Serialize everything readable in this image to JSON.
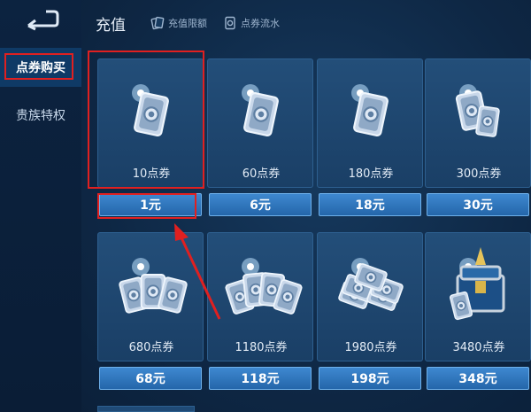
{
  "sidebar": {
    "items": [
      {
        "label": "点券购买",
        "active": true
      },
      {
        "label": "贵族特权",
        "active": false
      }
    ]
  },
  "header": {
    "title": "充值",
    "links": [
      {
        "label": "充值限额",
        "icon": "cards-icon"
      },
      {
        "label": "点券流水",
        "icon": "coin-icon"
      }
    ]
  },
  "products": [
    {
      "amount": "10点券",
      "price": "1元"
    },
    {
      "amount": "60点券",
      "price": "6元"
    },
    {
      "amount": "180点券",
      "price": "18元"
    },
    {
      "amount": "300点券",
      "price": "30元"
    },
    {
      "amount": "680点券",
      "price": "68元"
    },
    {
      "amount": "1180点券",
      "price": "118元"
    },
    {
      "amount": "1980点券",
      "price": "198元"
    },
    {
      "amount": "3480点券",
      "price": "348元"
    }
  ],
  "colors": {
    "accent": "#2f7bc4",
    "highlight": "#e02020",
    "background": "#0e2744"
  }
}
